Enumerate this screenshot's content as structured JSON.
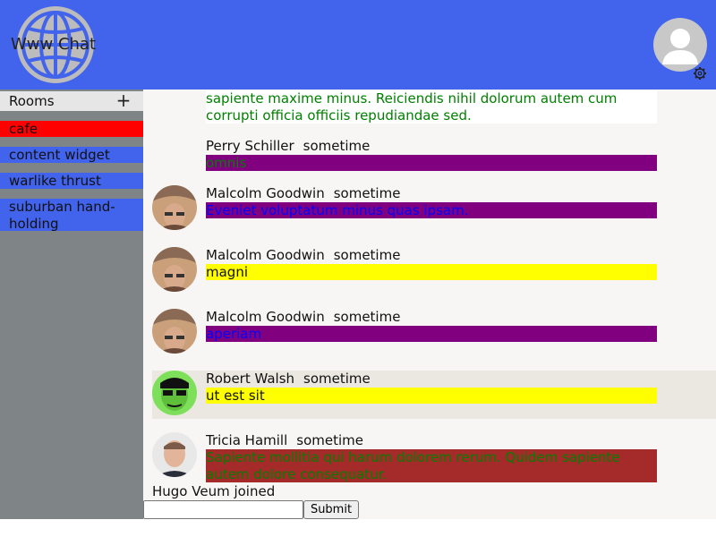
{
  "app": {
    "title": "Www Chat"
  },
  "colors": {
    "header": "#4263eb",
    "sidebar": "#7f8586",
    "room_active": "#ff0000",
    "room_default": "#4263eb",
    "purple": "#800080",
    "yellow": "#ffff00",
    "brown": "#a52a2a",
    "white": "#ffffff",
    "green_text": "#008000",
    "blue_text": "#0000ff"
  },
  "sidebar": {
    "rooms_label": "Rooms",
    "add_label": "+",
    "rooms": [
      {
        "label": "cafe"
      },
      {
        "label": "content widget"
      },
      {
        "label": "warlike thrust"
      },
      {
        "label": "suburban hand-holding"
      }
    ]
  },
  "messages": [
    {
      "author": "",
      "time": "",
      "text": "sapiente maxime minus. Reiciendis nihil dolorum autem cum corrupti officia officiis repudiandae sed."
    },
    {
      "author": "Perry Schiller",
      "time": "sometime",
      "text": "omnis"
    },
    {
      "author": "Malcolm Goodwin",
      "time": "sometime",
      "text": "Eveniet voluptatum minus quas ipsam."
    },
    {
      "author": "Malcolm Goodwin",
      "time": "sometime",
      "text": "magni"
    },
    {
      "author": "Malcolm Goodwin",
      "time": "sometime",
      "text": "aperiam"
    },
    {
      "author": "Robert Walsh",
      "time": "sometime",
      "text": "ut est sit"
    },
    {
      "author": "Tricia Hamill",
      "time": "sometime",
      "text": "Sapiente mollitia qui harum dolorem rerum. Quidem sapiente autem dolore consequatur."
    }
  ],
  "joined_notice": "Hugo Veum joined",
  "composer": {
    "placeholder": "",
    "submit_label": "Submit"
  }
}
